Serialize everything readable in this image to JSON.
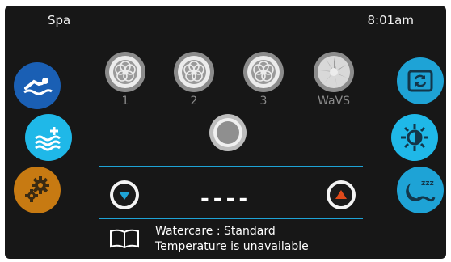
{
  "header": {
    "title": "Spa",
    "time": "8:01am"
  },
  "colors": {
    "background": "#171717",
    "accent_line": "#1ea3d6",
    "swim_button": "#1a5fb4",
    "heat_button": "#1fb8e8",
    "light_button": "#1fb8e8",
    "flip_button": "#1ea3d6",
    "settings_button": "#c77a12",
    "sleep_button": "#1ea3d6",
    "temp_up": "#e04a1b",
    "temp_down": "#1ea3d6"
  },
  "left_buttons": [
    {
      "name": "swim",
      "icon": "swimmer-icon"
    },
    {
      "name": "heat",
      "icon": "heat-waves-icon"
    },
    {
      "name": "settings",
      "icon": "gears-icon"
    }
  ],
  "right_buttons": [
    {
      "name": "flip",
      "icon": "flip-screen-icon"
    },
    {
      "name": "light",
      "icon": "light-icon"
    },
    {
      "name": "sleep",
      "icon": "sleep-icon"
    }
  ],
  "pumps": [
    {
      "label": "1",
      "icon": "jet-icon"
    },
    {
      "label": "2",
      "icon": "jet-icon"
    },
    {
      "label": "3",
      "icon": "jet-icon"
    },
    {
      "label": "WaVS",
      "icon": "wave-jet-icon"
    }
  ],
  "center": {
    "icon": "power-ring-icon"
  },
  "temperature": {
    "value": "----"
  },
  "status": {
    "icon": "book-icon",
    "line1": "Watercare : Standard",
    "line2": "Temperature is unavailable"
  }
}
